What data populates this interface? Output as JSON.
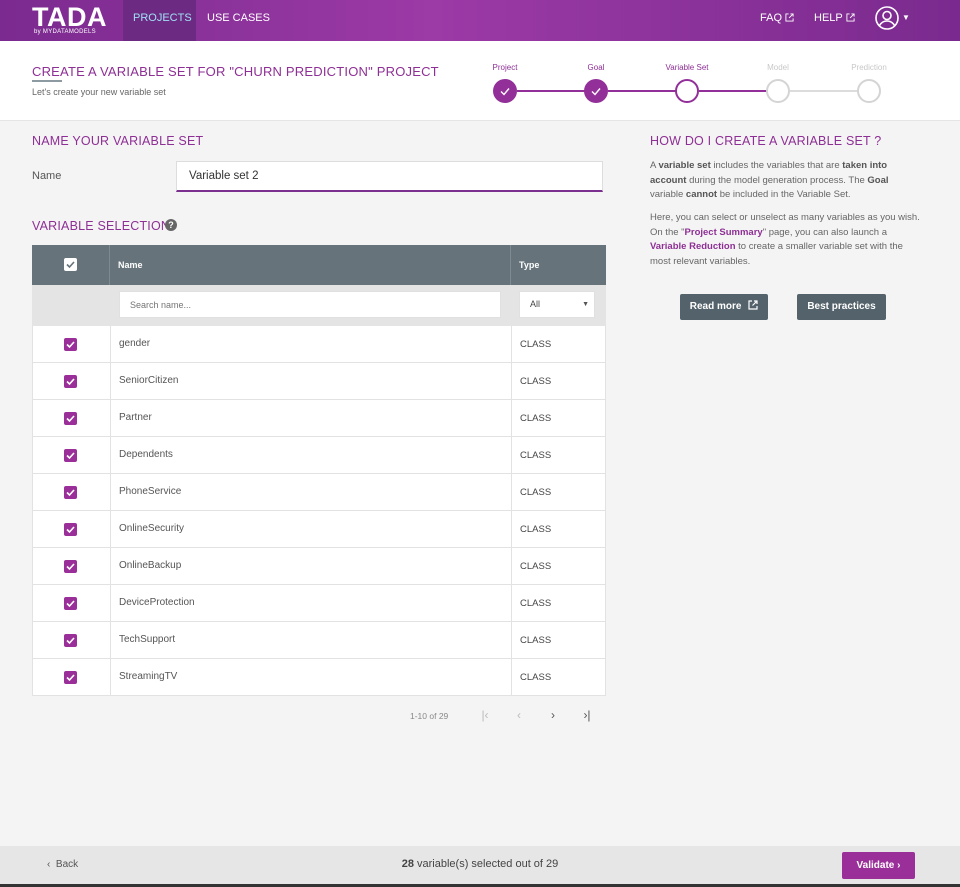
{
  "navbar": {
    "logo_main": "TADA",
    "logo_sub": "by MYDATAMODELS",
    "tabs": [
      {
        "label": "PROJECTS",
        "active": true
      },
      {
        "label": "USE CASES",
        "active": false
      }
    ],
    "faq_label": "FAQ",
    "help_label": "HELP"
  },
  "header": {
    "title": "CREATE A VARIABLE SET FOR \"CHURN PREDICTION\" PROJECT",
    "subtitle": "Let's create your new variable set",
    "steps": [
      {
        "label": "Project",
        "state": "done"
      },
      {
        "label": "Goal",
        "state": "done"
      },
      {
        "label": "Variable Set",
        "state": "current"
      },
      {
        "label": "Model",
        "state": "future"
      },
      {
        "label": "Prediction",
        "state": "future"
      }
    ]
  },
  "name_section": {
    "title": "NAME YOUR VARIABLE SET",
    "label": "Name",
    "value": "Variable set 2"
  },
  "selection": {
    "title": "VARIABLE SELECTION",
    "columns": {
      "name": "Name",
      "type": "Type"
    },
    "search_placeholder": "Search name...",
    "type_filter": "All",
    "rows": [
      {
        "name": "gender",
        "type": "CLASS",
        "checked": true
      },
      {
        "name": "SeniorCitizen",
        "type": "CLASS",
        "checked": true
      },
      {
        "name": "Partner",
        "type": "CLASS",
        "checked": true
      },
      {
        "name": "Dependents",
        "type": "CLASS",
        "checked": true
      },
      {
        "name": "PhoneService",
        "type": "CLASS",
        "checked": true
      },
      {
        "name": "OnlineSecurity",
        "type": "CLASS",
        "checked": true
      },
      {
        "name": "OnlineBackup",
        "type": "CLASS",
        "checked": true
      },
      {
        "name": "DeviceProtection",
        "type": "CLASS",
        "checked": true
      },
      {
        "name": "TechSupport",
        "type": "CLASS",
        "checked": true
      },
      {
        "name": "StreamingTV",
        "type": "CLASS",
        "checked": true
      }
    ],
    "pager_text": "1-10 of 29"
  },
  "help_panel": {
    "title": "HOW DO I CREATE A VARIABLE SET ?",
    "p1": {
      "a": "A ",
      "b": "variable set",
      "c": " includes the variables that are ",
      "d": "taken into account",
      "e": " during the model generation process. The ",
      "f": "Goal",
      "g": " variable ",
      "h": "cannot",
      "i": " be included in the Variable Set."
    },
    "p2": {
      "a": "Here, you can select or unselect as many variables as you wish.",
      "b": "On the \"",
      "c": "Project Summary",
      "d": "\" page, you can also launch a ",
      "e": "Variable Reduction",
      "f": " to create a smaller variable set with the most relevant variables."
    },
    "read_more_label": "Read more",
    "best_practices_label": "Best practices"
  },
  "footer": {
    "back_label": "Back",
    "selected_count": "28",
    "selected_text": " variable(s) selected out of 29",
    "validate_label": "Validate"
  },
  "colors": {
    "accent": "#922f99",
    "header_gradient_start": "#7b2a8f",
    "table_header": "#66737a"
  }
}
